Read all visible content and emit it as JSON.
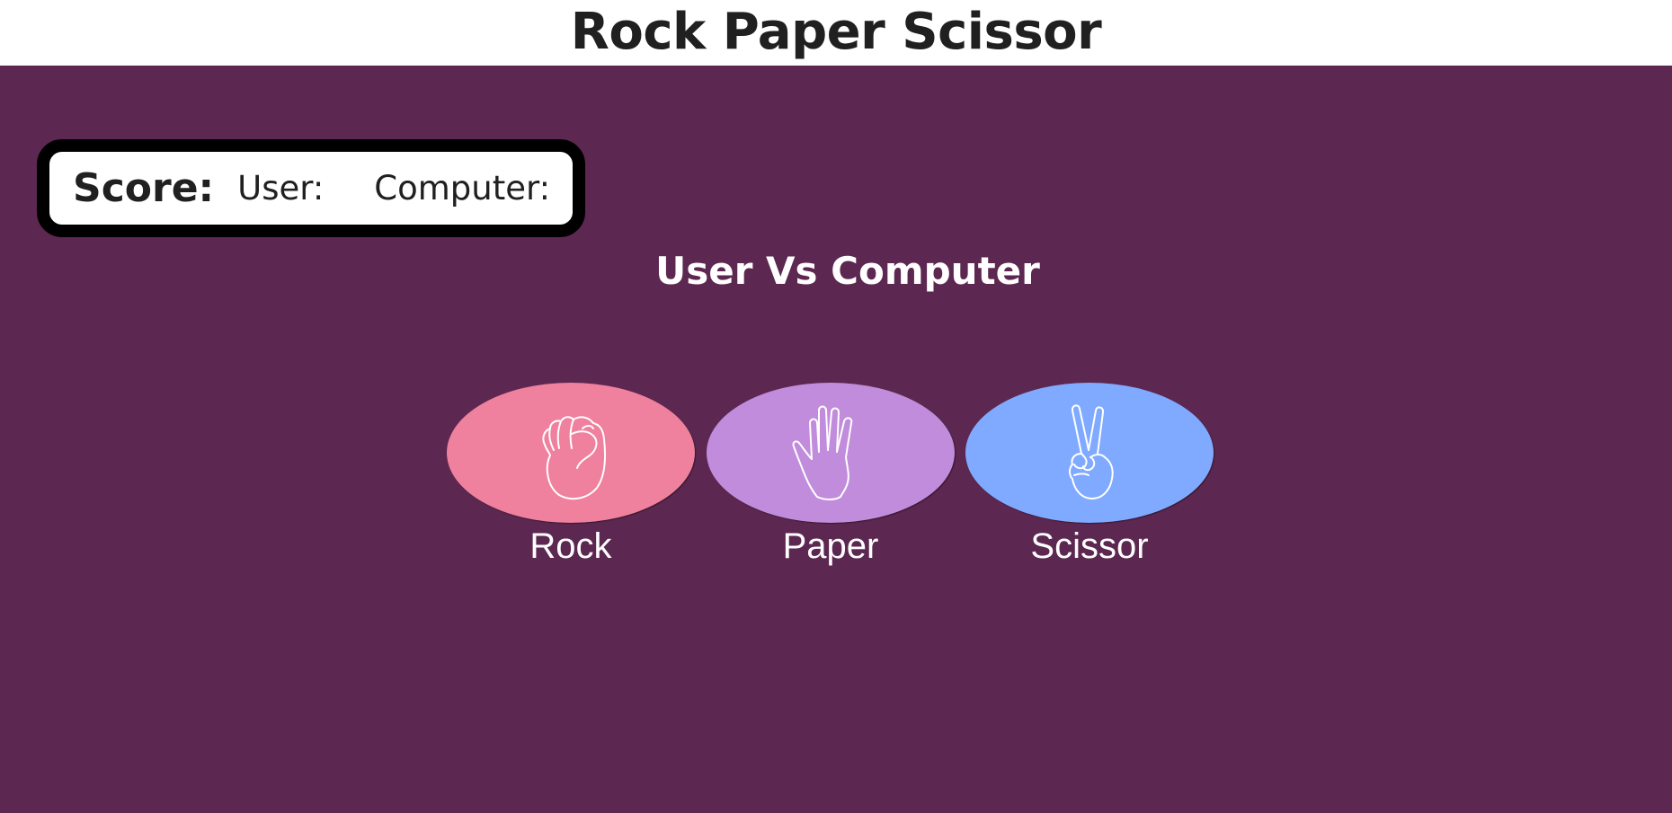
{
  "app": {
    "title": "Rock Paper Scissor"
  },
  "score": {
    "label": "Score:",
    "user_label": "User:",
    "computer_label": "Computer:"
  },
  "versus": {
    "text": "User Vs Computer"
  },
  "choices": [
    {
      "label": "Rock",
      "icon": "fist-icon",
      "color": "#ef809e"
    },
    {
      "label": "Paper",
      "icon": "open-hand-icon",
      "color": "#c08cdb"
    },
    {
      "label": "Scissor",
      "icon": "peace-sign-icon",
      "color": "#80aaff"
    }
  ],
  "colors": {
    "background": "#5c2750",
    "header_background": "#ffffff",
    "title_text": "#202020",
    "score_border": "#000000"
  }
}
